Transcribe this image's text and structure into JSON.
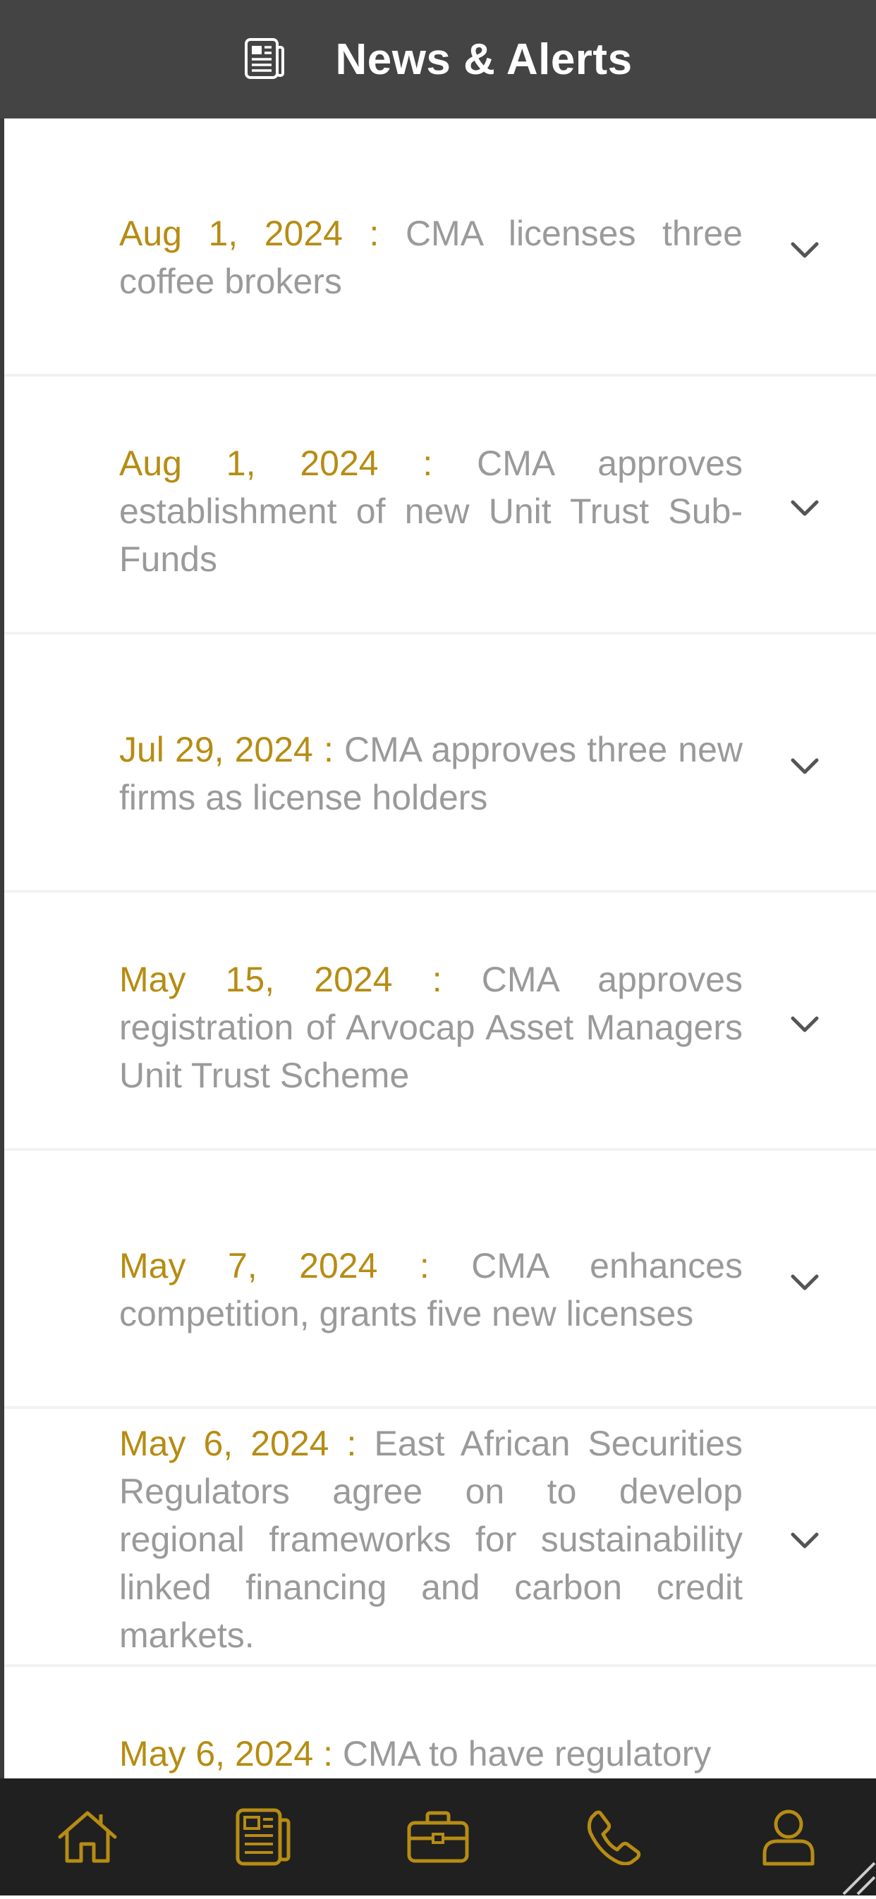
{
  "header": {
    "title": "News & Alerts",
    "icon": "newspaper-icon"
  },
  "colors": {
    "header_bg": "#444444",
    "accent_gold": "#b68c13",
    "body_text": "#9a9a9a",
    "tabbar_bg": "#202020"
  },
  "news": [
    {
      "date": "Aug 1, 2024",
      "separator": " : ",
      "headline": "CMA licenses three coffee brokers"
    },
    {
      "date": "Aug 1, 2024",
      "separator": " : ",
      "headline": "CMA approves establishment of new Unit Trust Sub-Funds"
    },
    {
      "date": "Jul 29, 2024",
      "separator": " : ",
      "headline": "CMA approves three new firms as license holders"
    },
    {
      "date": "May 15, 2024",
      "separator": " : ",
      "headline": "CMA approves registration of Arvocap Asset Managers Unit Trust Scheme"
    },
    {
      "date": "May 7, 2024",
      "separator": " : ",
      "headline": "CMA enhances competition, grants five new licenses"
    },
    {
      "date": "May 6, 2024",
      "separator": " : ",
      "headline": "East African Securities Regulators agree on to develop regional frameworks for sustainability linked financing and carbon credit markets."
    },
    {
      "date": "May 6, 2024",
      "separator": " : ",
      "headline": "CMA to have regulatory"
    }
  ],
  "tabbar": {
    "items": [
      {
        "icon": "home-icon"
      },
      {
        "icon": "newspaper-icon"
      },
      {
        "icon": "briefcase-icon"
      },
      {
        "icon": "phone-icon"
      },
      {
        "icon": "user-icon"
      }
    ]
  }
}
